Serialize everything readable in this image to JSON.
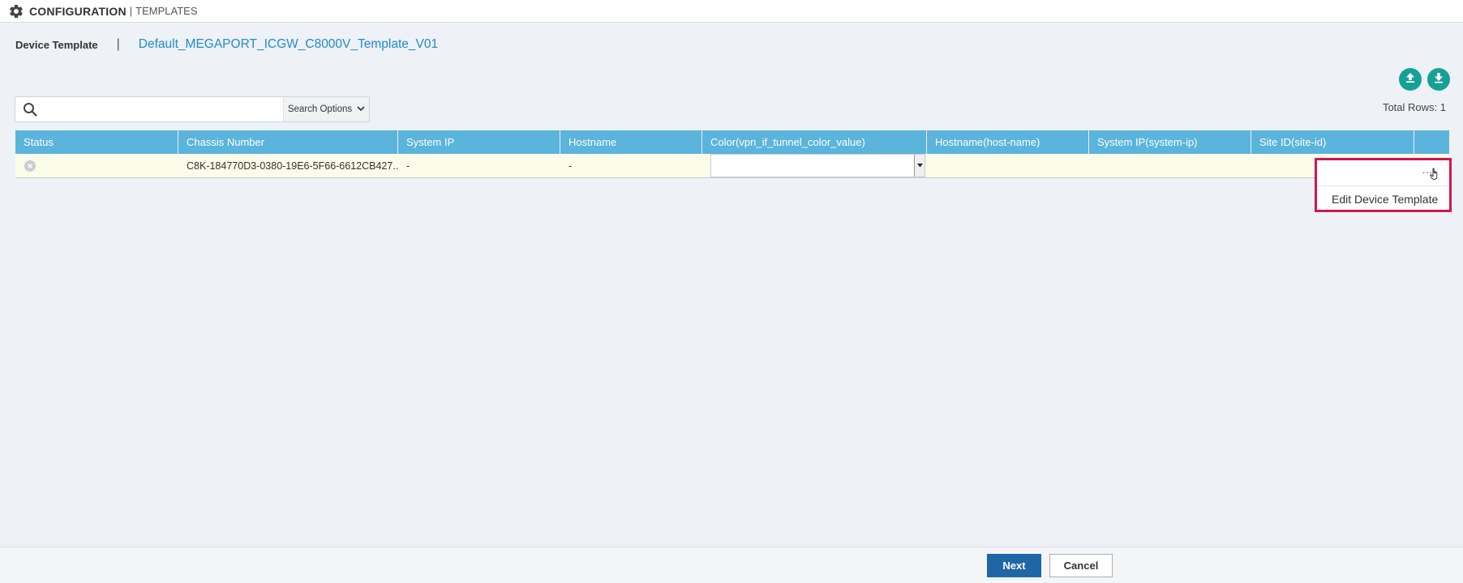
{
  "header": {
    "section": "CONFIGURATION",
    "separator": "|",
    "subsection": "TEMPLATES",
    "icon": "gear-icon"
  },
  "breadcrumb": {
    "label": "Device Template",
    "separator": "|",
    "template_name": "Default_MEGAPORT_ICGW_C8000V_Template_V01"
  },
  "toolbar": {
    "upload_icon": "upload-icon",
    "download_icon": "download-icon"
  },
  "search": {
    "value": "",
    "placeholder": "",
    "options_label": "Search Options"
  },
  "total_rows": "Total Rows: 1",
  "table": {
    "columns": [
      "Status",
      "Chassis Number",
      "System IP",
      "Hostname",
      "Color(vpn_if_tunnel_color_value)",
      "Hostname(host-name)",
      "System IP(system-ip)",
      "Site ID(site-id)",
      ""
    ],
    "rows": [
      {
        "status": "error",
        "chassis_number": "C8K-184770D3-0380-19E6-5F66-6612CB427...",
        "system_ip": "-",
        "hostname": "-",
        "color": "",
        "host_name": "",
        "system_ip_field": "",
        "site_id": ""
      }
    ]
  },
  "context_menu": {
    "trigger": "...",
    "items": [
      "Edit Device Template"
    ]
  },
  "footer": {
    "next_label": "Next",
    "cancel_label": "Cancel"
  },
  "colors": {
    "header_blue": "#5ab4dc",
    "accent_teal": "#16a096",
    "primary_button": "#1f66a6",
    "highlight_red": "#d0174d",
    "link_blue": "#1f8bd0",
    "row_highlight": "#fbfce9"
  }
}
